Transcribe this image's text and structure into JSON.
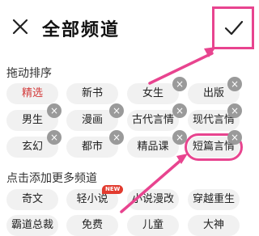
{
  "header": {
    "title": "全部频道"
  },
  "sections": {
    "drag_sort": "拖动排序",
    "add_more": "点击添加更多频道"
  },
  "my_channels": [
    "精选",
    "新书",
    "女生",
    "出版",
    "男生",
    "漫画",
    "古代言情",
    "现代言情",
    "玄幻",
    "都市",
    "精品课",
    "短篇言情"
  ],
  "more_channels": [
    "奇文",
    "轻小说",
    "小说漫改",
    "穿越重生",
    "霸道总裁",
    "免费",
    "儿童",
    "大神"
  ],
  "badges": {
    "new": "NEW"
  },
  "colors": {
    "annotation": "#e8448f",
    "selected_text": "#d33a3a",
    "chip_bg": "#f1f1f1",
    "new_badge": "#e23b2f"
  }
}
